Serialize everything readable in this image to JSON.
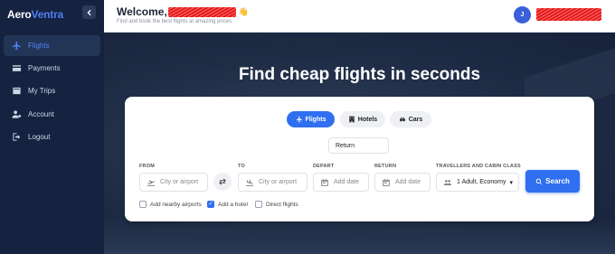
{
  "brand": {
    "name_part1": "Aero",
    "name_part2": "Ventra",
    "accent": "#4f7ef0"
  },
  "sidebar": {
    "collapse_icon": "chevron-left-icon",
    "items": [
      {
        "label": "Flights",
        "icon": "plane-icon",
        "active": true
      },
      {
        "label": "Payments",
        "icon": "credit-card-icon",
        "active": false
      },
      {
        "label": "My Trips",
        "icon": "trips-icon",
        "active": false
      },
      {
        "label": "Account",
        "icon": "user-gear-icon",
        "active": false
      },
      {
        "label": "Logout",
        "icon": "logout-icon",
        "active": false
      }
    ]
  },
  "header": {
    "welcome": "Welcome,",
    "wave": "👋",
    "subtitle": "Find and book the best flights at amazing prices",
    "avatar_initial": "J"
  },
  "hero": {
    "title": "Find cheap flights in seconds"
  },
  "search": {
    "tabs": [
      {
        "label": "Flights",
        "icon": "plane-icon",
        "active": true
      },
      {
        "label": "Hotels",
        "icon": "hotel-icon",
        "active": false
      },
      {
        "label": "Cars",
        "icon": "car-icon",
        "active": false
      }
    ],
    "trip_type": "Return",
    "from_label": "FROM",
    "from_placeholder": "City or airport",
    "to_label": "TO",
    "to_placeholder": "City or airport",
    "depart_label": "DEPART",
    "depart_placeholder": "Add date",
    "return_label": "RETURN",
    "return_placeholder": "Add date",
    "travellers_label": "TRAVELLERS AND CABIN CLASS",
    "travellers_value": "1 Adult, Economy",
    "search_button": "Search",
    "options": [
      {
        "label": "Add nearby airports",
        "checked": false
      },
      {
        "label": "Add a hotel",
        "checked": true
      },
      {
        "label": "Direct flights",
        "checked": false
      }
    ]
  },
  "colors": {
    "sidebar_bg": "#152341",
    "primary": "#2f6ff0",
    "active_nav": "#4f86ff"
  }
}
